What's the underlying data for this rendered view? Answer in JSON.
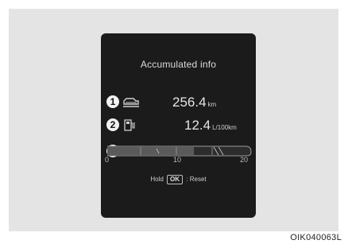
{
  "screen": {
    "title": "Accumulated info",
    "distance": {
      "badge": "1",
      "icon": "car-distance-icon",
      "value": "256.4",
      "unit": "km"
    },
    "fuel_economy": {
      "badge": "2",
      "icon": "fuel-pump-icon",
      "value": "12.4",
      "unit": "L/100km"
    },
    "gauge": {
      "badge": "3",
      "min_label": "0",
      "mid_label": "10",
      "max_label": "20",
      "level": 12.4,
      "max": 20
    },
    "reset_hint": {
      "prefix": "Hold",
      "button": "OK",
      "suffix": ": Reset"
    }
  },
  "figure_code": "OIK040063L",
  "colors": {
    "screen_bg": "#1b1b1b",
    "panel_bg": "#e4e4e4",
    "text": "#d9d9d9"
  }
}
